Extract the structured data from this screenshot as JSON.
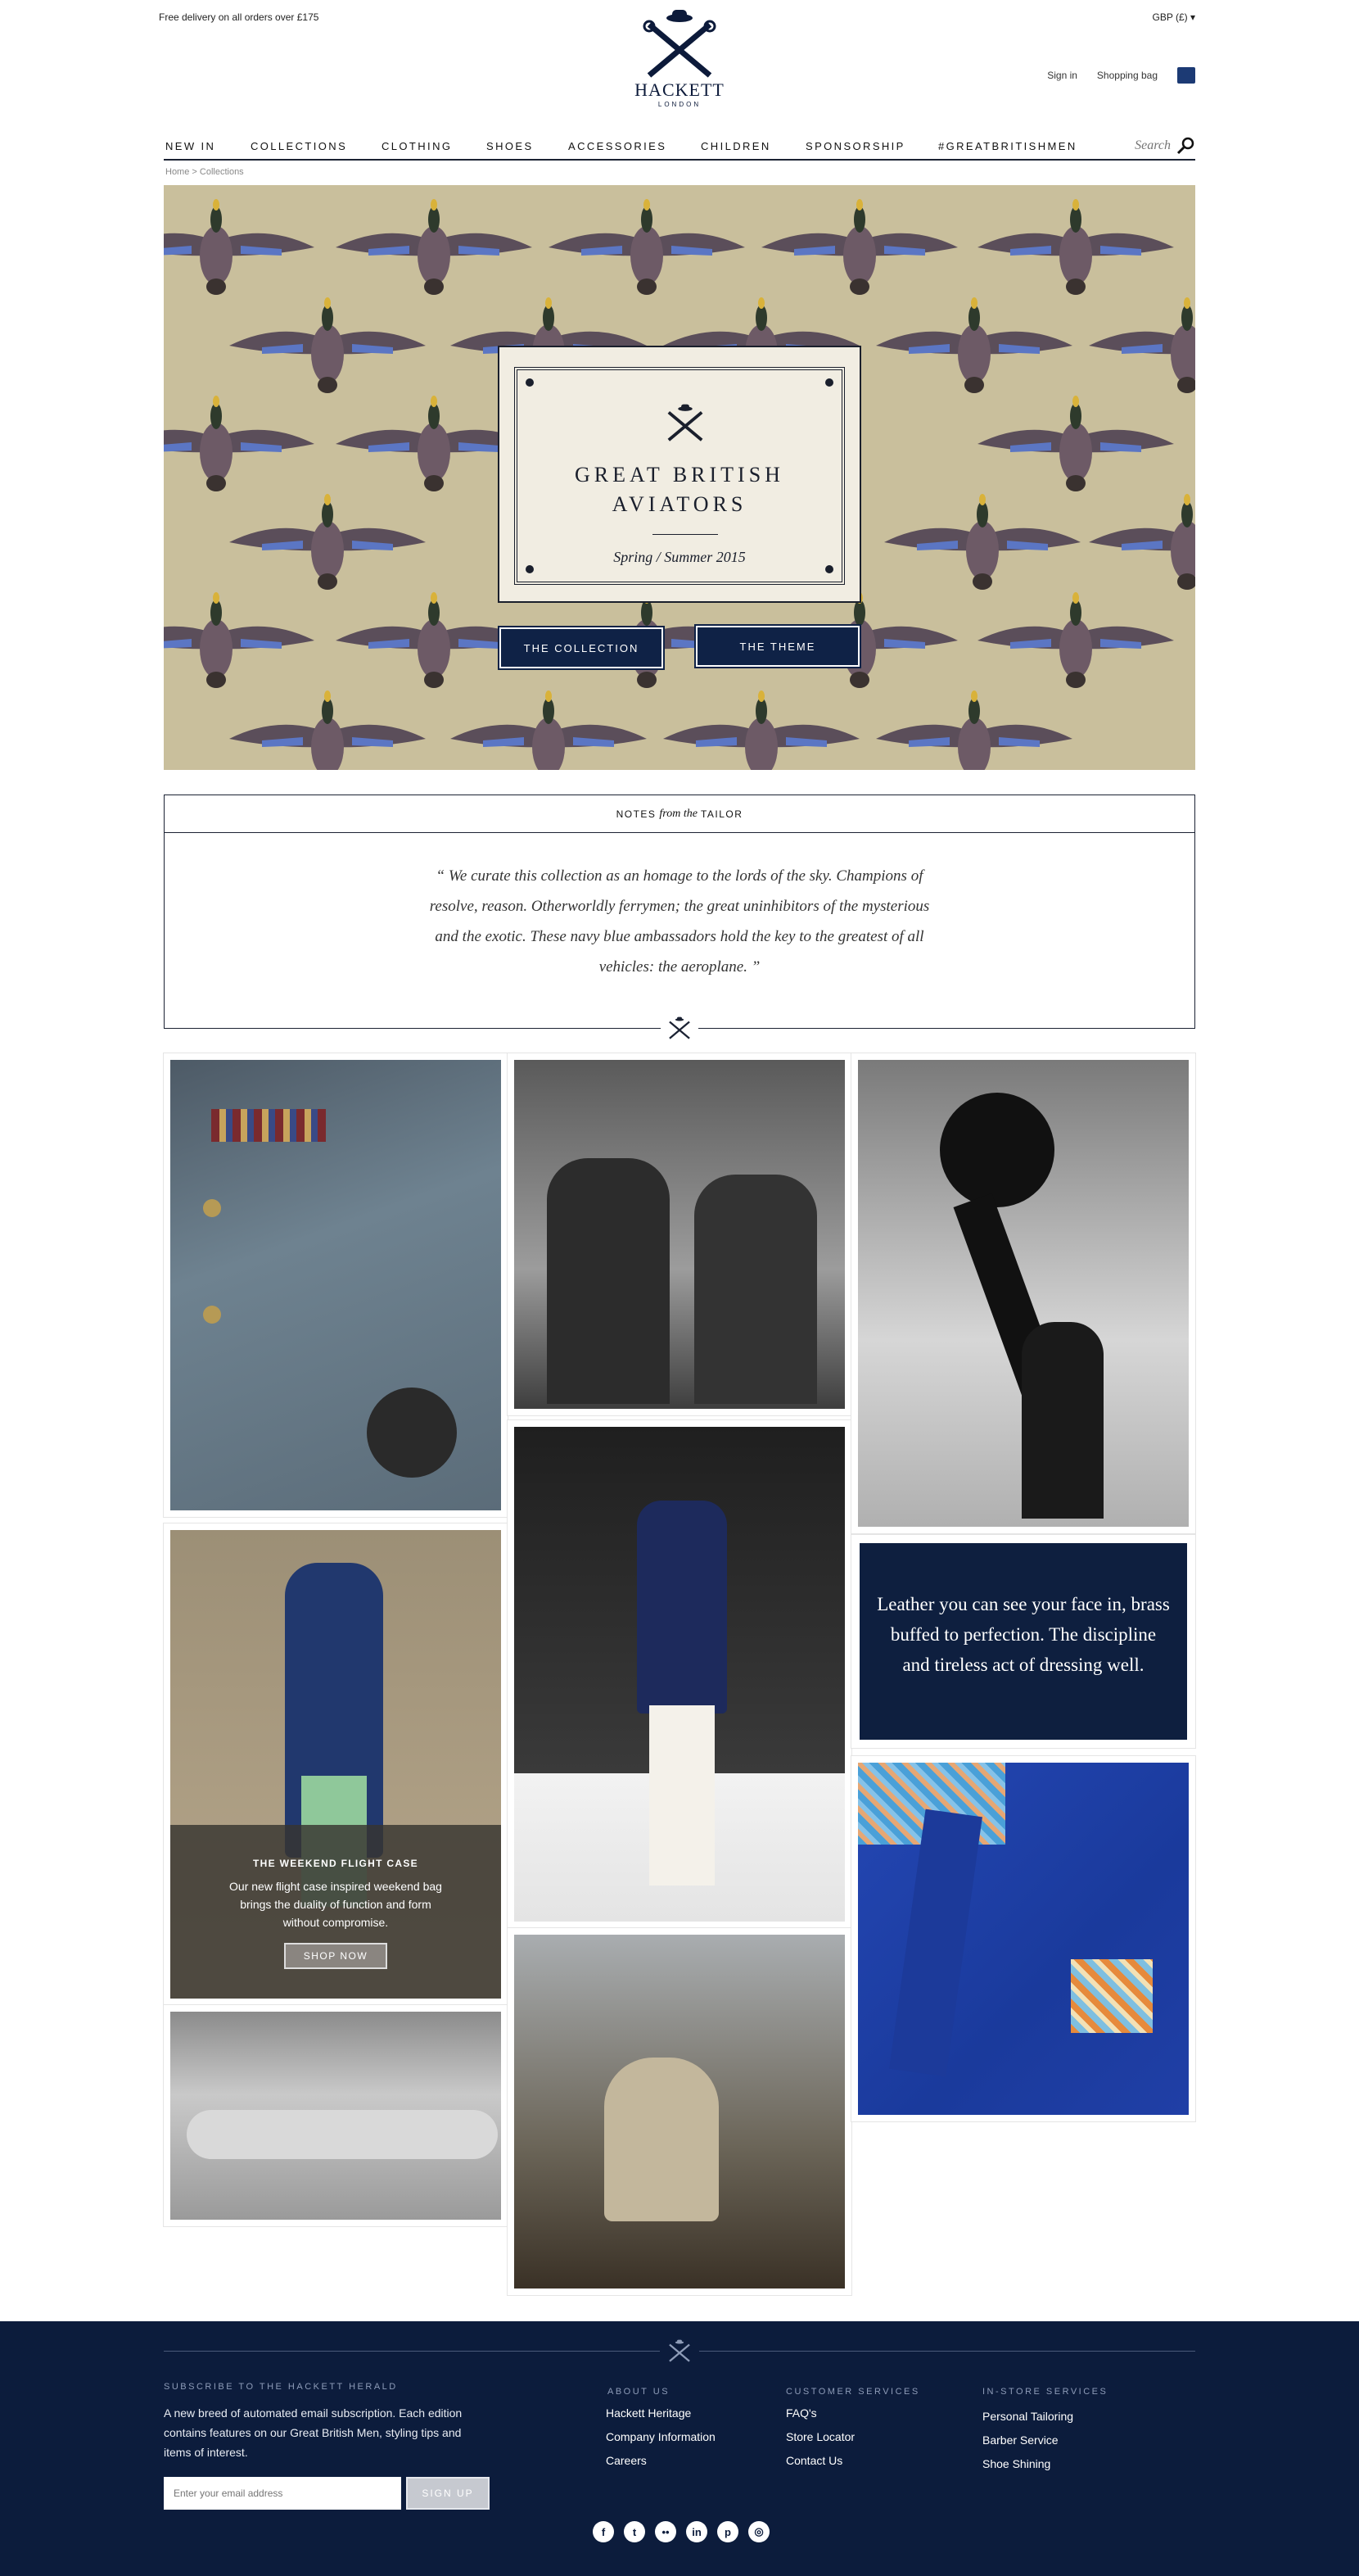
{
  "top_bar": {
    "delivery_note": "Free delivery on all orders over £175",
    "currency": "GBP (£) ▾"
  },
  "brand": {
    "word": "HACKETT",
    "sub": "LONDON",
    "navy": "#0c1a3a"
  },
  "utility": {
    "sign_in": "Sign in",
    "bag": "Shopping bag"
  },
  "nav": {
    "items": [
      "NEW IN",
      "COLLECTIONS",
      "CLOTHING",
      "SHOES",
      "ACCESSORIES",
      "CHILDREN",
      "SPONSORSHIP",
      "#GREATBRITISHMEN"
    ],
    "search_placeholder": "Search"
  },
  "breadcrumb": "Home > Collections",
  "hero": {
    "title_line1": "GREAT BRITISH",
    "title_line2": "AVIATORS",
    "subtitle": "Spring / Summer 2015",
    "btn_collection": "THE COLLECTION",
    "btn_theme": "THE THEME",
    "bg": "#c9bf9c"
  },
  "notes": {
    "head_a": "NOTES",
    "head_b": "from the",
    "head_c": "TAILOR",
    "quote": "“ We curate this collection as an homage to the lords of the sky. Champions of resolve, reason. Otherworldly ferrymen; the great uninhibitors of the mysterious and the exotic. These navy blue ambassadors hold the key to the greatest of all vehicles: the aeroplane. ”"
  },
  "promo": {
    "title": "THE WEEKEND FLIGHT CASE",
    "desc": "Our new flight case inspired weekend bag brings the duality of function and form without compromise.",
    "button": "SHOP NOW"
  },
  "dark_card": "Leather you can see your face in, brass buffed to perfection. The discipline and tireless act of dressing well.",
  "footer": {
    "subscribe_head": "SUBSCRIBE TO THE HACKETT HERALD",
    "subscribe_text": "A new breed of automated email subscription.  Each edition contains features on our Great British Men, styling tips and items of interest.",
    "email_placeholder": "Enter your email address",
    "signup": "SIGN UP",
    "about_head": "ABOUT US",
    "about": [
      "Hackett Heritage",
      "Company Information",
      "Careers"
    ],
    "cs_head": "CUSTOMER SERVICES",
    "cs": [
      "FAQ's",
      "Store Locator",
      "Contact Us"
    ],
    "instore_head": "IN-STORE SERVICES",
    "instore": [
      "Personal Tailoring",
      "Barber Service",
      "Shoe Shining"
    ],
    "social": [
      "facebook-icon",
      "twitter-icon",
      "flickr-icon",
      "linkedin-icon",
      "pinterest-icon",
      "instagram-icon"
    ]
  }
}
